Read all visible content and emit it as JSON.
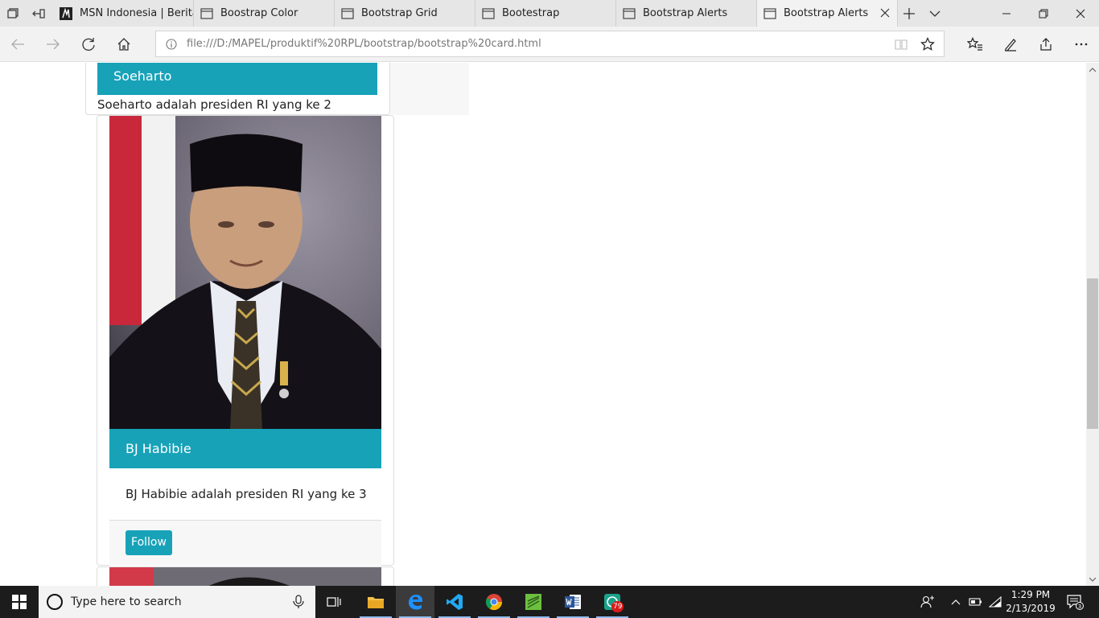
{
  "tabs": [
    {
      "label": "MSN Indonesia | Berita",
      "icon": "msn-icon"
    },
    {
      "label": "Boostrap Color",
      "icon": "page-icon"
    },
    {
      "label": "Bootstrap Grid",
      "icon": "page-icon"
    },
    {
      "label": "Bootestrap",
      "icon": "page-icon"
    },
    {
      "label": "Bootstrap Alerts",
      "icon": "page-icon"
    },
    {
      "label": "Bootstrap Alerts",
      "icon": "page-icon",
      "active": true
    }
  ],
  "address": {
    "url": "file:///D:/MAPEL/produktif%20RPL/bootstrap/bootstrap%20card.html"
  },
  "page": {
    "card1": {
      "title": "Soeharto",
      "text": "Soeharto adalah presiden RI yang ke 2"
    },
    "card2": {
      "title": "BJ Habibie",
      "text": "BJ Habibie adalah presiden RI yang ke 3",
      "button": "Follow"
    }
  },
  "taskbar": {
    "search_placeholder": "Type here to search",
    "apps": [
      "file-explorer-icon",
      "edge-icon",
      "vscode-icon",
      "chrome-icon",
      "sublime-icon",
      "word-icon",
      "messenger-icon"
    ],
    "messenger_badge": "79",
    "clock_time": "1:29 PM",
    "clock_date": "2/13/2019",
    "notification_count": "3"
  },
  "colors": {
    "accent": "#17a2b8",
    "taskbar": "#1c1c1c"
  }
}
